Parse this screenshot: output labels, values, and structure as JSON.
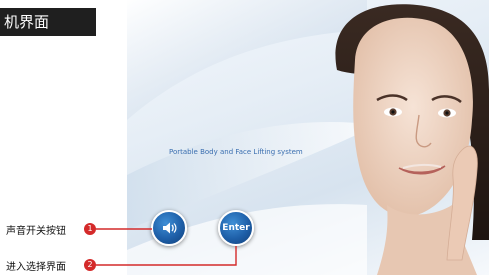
{
  "header": {
    "title": "机界面"
  },
  "screen": {
    "subtitle": "Portable Body and Face Lifting system",
    "buttons": {
      "sound_icon": "speaker-icon",
      "enter_label": "Enter"
    }
  },
  "annotations": [
    {
      "number": "1",
      "label": "声音开关按钮"
    },
    {
      "number": "2",
      "label": "进入选择界面"
    }
  ],
  "colors": {
    "accent": "#1e5fa8",
    "badge": "#d42a2a",
    "leader_line": "#d42a2a",
    "title_bar": "#1f1f1f"
  }
}
